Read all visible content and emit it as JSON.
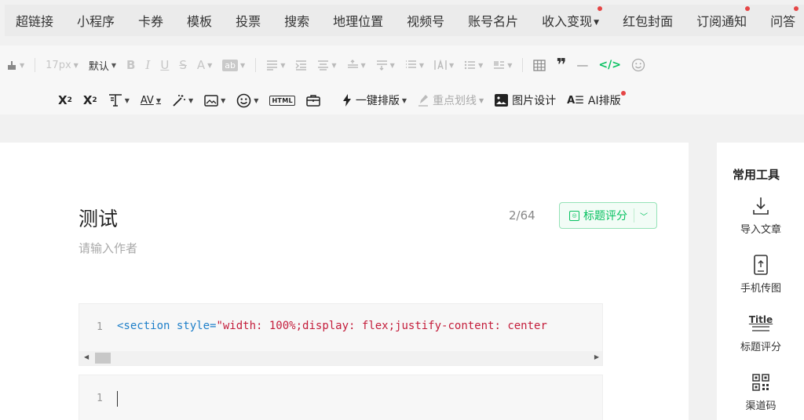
{
  "insert_bar": {
    "items": [
      {
        "label": "超链接"
      },
      {
        "label": "小程序"
      },
      {
        "label": "卡券"
      },
      {
        "label": "模板"
      },
      {
        "label": "投票"
      },
      {
        "label": "搜索"
      },
      {
        "label": "地理位置"
      },
      {
        "label": "视频号"
      },
      {
        "label": "账号名片"
      },
      {
        "label": "收入变现"
      },
      {
        "label": "红包封面"
      },
      {
        "label": "订阅通知"
      },
      {
        "label": "问答"
      }
    ]
  },
  "toolbar": {
    "font_size": "17px",
    "font_default": "默认",
    "bold": "B",
    "italic": "I",
    "underline": "U",
    "strike": "S",
    "font_color": "A",
    "bg_color": "ab",
    "quote": "❞",
    "divider": "—",
    "code": "</>",
    "superscript_base": "X",
    "superscript_mark": "2",
    "subscript_base": "X",
    "subscript_mark": "2",
    "letter_spacing": "AV",
    "html": "HTML",
    "one_click_layout": "一键排版",
    "highlight_underline": "重点划线",
    "image_design": "图片设计",
    "ai_layout": "AI排版",
    "ai_layout_icon": "A☰"
  },
  "editor": {
    "title": "测试",
    "title_counter": "2/64",
    "title_score_button": "标题评分",
    "author_placeholder": "请输入作者",
    "code_block_1": {
      "line_number": "1",
      "tag": "<section",
      "attr": " style=",
      "value": "\"width: 100%;display: flex;justify-content: center"
    },
    "code_block_2": {
      "line_number": "1"
    }
  },
  "tools_panel": {
    "title": "常用工具",
    "items": [
      {
        "label": "导入文章",
        "icon": "import-icon"
      },
      {
        "label": "手机传图",
        "icon": "phone-upload-icon"
      },
      {
        "label": "标题评分",
        "icon": "title-score-icon",
        "glyph_text": "Title"
      },
      {
        "label": "渠道码",
        "icon": "qr-code-icon"
      }
    ]
  },
  "colors": {
    "accent_green": "#07c160",
    "notification_dot": "#e54545",
    "code_tag": "#1e7fc9",
    "code_string": "#c41d3b"
  }
}
